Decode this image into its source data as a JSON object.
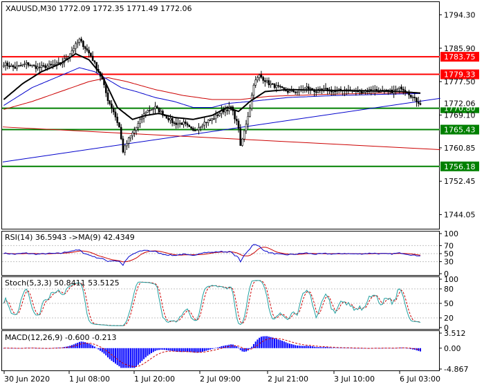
{
  "window": {
    "title": "XAUUSD,M30 1772.09 1772.35 1771.49 1772.06"
  },
  "colors": {
    "background": "#ffffff",
    "frame": "#000000",
    "grid": "#c0c0c0",
    "candle": "#000000",
    "ma_black": "#000000",
    "ma_blue": "#0000cc",
    "ma_red": "#cc0000",
    "trend_blue": "#0000cc",
    "trend_red": "#cc0000",
    "resistance": "#ff0000",
    "support": "#008000",
    "rsi_line": "#0000cc",
    "rsi_ma": "#cc0000",
    "stoch_main": "#20a0a0",
    "stoch_signal": "#cc0000",
    "macd_hist": "#0000ff",
    "macd_signal": "#cc0000",
    "level_label_text": "#ffffff",
    "price_label_bg": "#ffffff"
  },
  "price_axis": {
    "ticks": [
      "1794.30",
      "1785.90",
      "1777.50",
      "1769.10",
      "1760.85",
      "1752.45",
      "1744.05"
    ]
  },
  "current_price": "1772.06",
  "levels": [
    {
      "value": 1783.75,
      "label": "1783.75",
      "kind": "resistance"
    },
    {
      "value": 1779.33,
      "label": "1779.33",
      "kind": "resistance"
    },
    {
      "value": 1770.8,
      "label": "1770.80",
      "kind": "support"
    },
    {
      "value": 1765.43,
      "label": "1765.43",
      "kind": "support"
    },
    {
      "value": 1756.18,
      "label": "1756.18",
      "kind": "support"
    }
  ],
  "time_axis": {
    "labels": [
      "30 Jun 2020",
      "1 Jul 08:00",
      "1 Jul 20:00",
      "2 Jul 09:00",
      "2 Jul 21:00",
      "3 Jul 10:00",
      "6 Jul 03:00"
    ]
  },
  "rsi": {
    "title": "RSI(14) 36.5943 ->MA(9) 42.4349",
    "ticks": [
      "100",
      "70",
      "50",
      "30",
      "0"
    ],
    "ylim": [
      0,
      100
    ]
  },
  "stoch": {
    "title": "Stoch(5,3,3) 50.8411 53.5125",
    "ticks": [
      "100",
      "80",
      "50",
      "20",
      "0"
    ],
    "ylim": [
      0,
      100
    ]
  },
  "macd": {
    "title": "MACD(12,26,9) -0.600 -0.213",
    "ticks": [
      "3.512",
      "0.00",
      "-4.867"
    ],
    "ylim": [
      -4.867,
      3.512
    ]
  },
  "chart_data": {
    "type": "candlestick",
    "symbol": "XAUUSD",
    "timeframe": "M30",
    "ylim": [
      1740.5,
      1797.5
    ],
    "close_path": [
      [
        0,
        1782
      ],
      [
        6,
        1781
      ],
      [
        12,
        1782
      ],
      [
        18,
        1781
      ],
      [
        24,
        1781.5
      ],
      [
        30,
        1782
      ],
      [
        34,
        1784
      ],
      [
        37,
        1786
      ],
      [
        40,
        1788
      ],
      [
        43,
        1786
      ],
      [
        46,
        1784
      ],
      [
        49,
        1781
      ],
      [
        52,
        1778
      ],
      [
        55,
        1773
      ],
      [
        58,
        1770
      ],
      [
        61,
        1766
      ],
      [
        63,
        1760
      ],
      [
        66,
        1763
      ],
      [
        70,
        1766
      ],
      [
        75,
        1770
      ],
      [
        80,
        1771
      ],
      [
        85,
        1769
      ],
      [
        90,
        1767
      ],
      [
        95,
        1767
      ],
      [
        100,
        1765
      ],
      [
        105,
        1767
      ],
      [
        110,
        1768
      ],
      [
        115,
        1770
      ],
      [
        120,
        1771
      ],
      [
        124,
        1766
      ],
      [
        125,
        1761
      ],
      [
        127,
        1765
      ],
      [
        130,
        1771
      ],
      [
        132,
        1777
      ],
      [
        135,
        1779
      ],
      [
        140,
        1777
      ],
      [
        145,
        1776
      ],
      [
        150,
        1775
      ],
      [
        155,
        1775
      ],
      [
        160,
        1776
      ],
      [
        165,
        1775
      ],
      [
        170,
        1775.5
      ],
      [
        175,
        1775
      ],
      [
        180,
        1775.5
      ],
      [
        185,
        1775
      ],
      [
        190,
        1775
      ],
      [
        195,
        1775.5
      ],
      [
        200,
        1775
      ],
      [
        205,
        1775
      ],
      [
        210,
        1776
      ],
      [
        213,
        1775
      ],
      [
        217,
        1773
      ],
      [
        220,
        1772
      ]
    ],
    "ma_black": [
      [
        0,
        1773
      ],
      [
        10,
        1777
      ],
      [
        20,
        1780
      ],
      [
        30,
        1782
      ],
      [
        38,
        1784.5
      ],
      [
        45,
        1783
      ],
      [
        52,
        1779
      ],
      [
        60,
        1771
      ],
      [
        68,
        1768
      ],
      [
        75,
        1769
      ],
      [
        82,
        1769.5
      ],
      [
        90,
        1768.5
      ],
      [
        100,
        1768
      ],
      [
        110,
        1769
      ],
      [
        118,
        1771
      ],
      [
        124,
        1770
      ],
      [
        130,
        1772.5
      ],
      [
        138,
        1775
      ],
      [
        150,
        1775.5
      ],
      [
        170,
        1775.3
      ],
      [
        190,
        1775.2
      ],
      [
        210,
        1775
      ],
      [
        220,
        1774.6
      ]
    ],
    "ma_blue": [
      [
        0,
        1771.5
      ],
      [
        15,
        1776
      ],
      [
        30,
        1779
      ],
      [
        40,
        1781
      ],
      [
        48,
        1780
      ],
      [
        55,
        1778
      ],
      [
        62,
        1776
      ],
      [
        70,
        1775
      ],
      [
        80,
        1773.5
      ],
      [
        90,
        1772.5
      ],
      [
        100,
        1771
      ],
      [
        110,
        1771
      ],
      [
        118,
        1772
      ],
      [
        130,
        1772.5
      ],
      [
        150,
        1773.5
      ],
      [
        175,
        1774
      ],
      [
        200,
        1774.3
      ],
      [
        220,
        1774.5
      ]
    ],
    "ma_red": [
      [
        0,
        1770.5
      ],
      [
        15,
        1772.5
      ],
      [
        30,
        1775
      ],
      [
        45,
        1777.5
      ],
      [
        55,
        1778.5
      ],
      [
        65,
        1777.5
      ],
      [
        80,
        1775.5
      ],
      [
        95,
        1774
      ],
      [
        110,
        1773
      ],
      [
        125,
        1773
      ],
      [
        140,
        1773.8
      ],
      [
        170,
        1774.3
      ],
      [
        200,
        1774.6
      ],
      [
        220,
        1774.7
      ]
    ],
    "trendline_blue": [
      [
        0,
        1757.3
      ],
      [
        230,
        1773.3
      ]
    ],
    "trendline_red": [
      [
        0,
        1766.1
      ],
      [
        230,
        1760.4
      ]
    ]
  }
}
